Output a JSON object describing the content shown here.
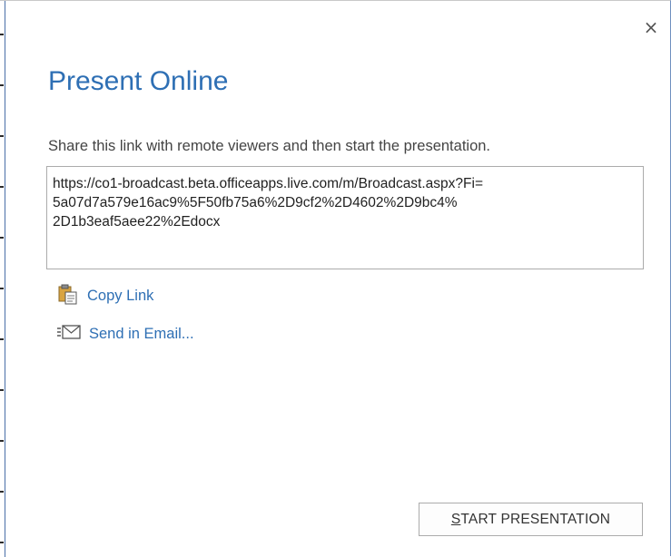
{
  "dialog": {
    "title": "Present Online",
    "close_glyph": "×",
    "instruction": "Share this link with remote viewers and then start the presentation.",
    "link_lines": [
      "https://co1-broadcast.beta.officeapps.live.com/m/Broadcast.aspx?Fi=",
      "5a07d7a579e16ac9%5F50fb75a6%2D9cf2%2D4602%2D9bc4%",
      "2D1b3eaf5aee22%2Edocx"
    ],
    "actions": {
      "copy_link": {
        "label": "Copy Link",
        "icon": "clipboard-icon"
      },
      "send_email": {
        "label": "Send in Email...",
        "icon": "email-icon"
      }
    },
    "start_button": {
      "mnemonic": "S",
      "rest": "TART PRESENTATION"
    }
  },
  "colors": {
    "accent": "#2e6fb4",
    "text": "#444444",
    "border": "#ababab"
  }
}
